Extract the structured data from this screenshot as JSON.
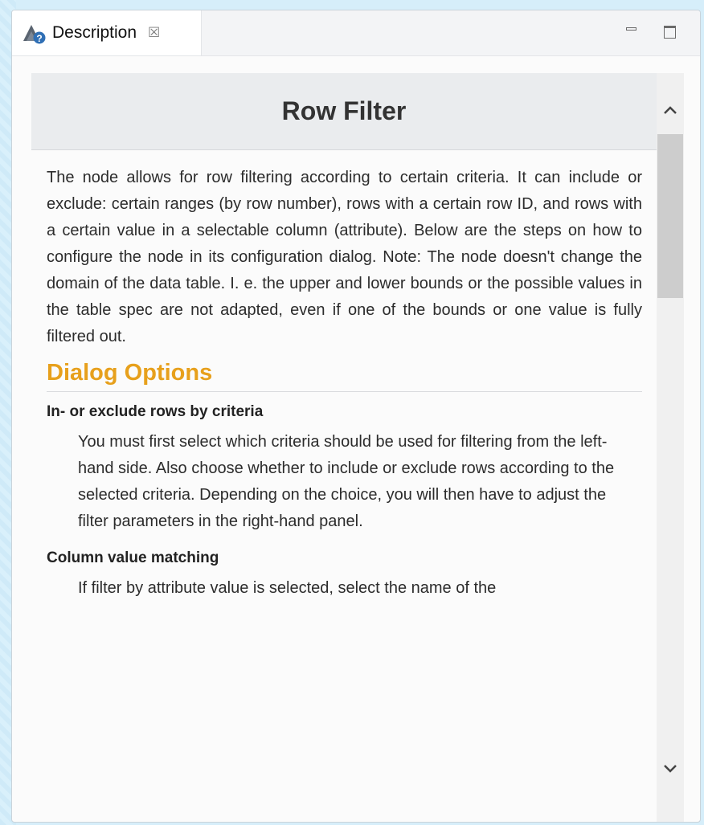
{
  "tab": {
    "label": "Description",
    "icon": "description-help-icon",
    "close_symbol": "☒"
  },
  "window_controls": {
    "minimize": "minimize-icon",
    "maximize": "maximize-icon"
  },
  "node": {
    "title": "Row Filter",
    "description": "The node allows for row filtering according to certain criteria. It can include or exclude: certain ranges (by row number), rows with a certain row ID, and rows with a certain value in a selectable column (attribute). Below are the steps on how to configure the node in its configuration dialog. Note: The node doesn't change the domain of the data table. I. e. the upper and lower bounds or the possible values in the table spec are not adapted, even if one of the bounds or one value is fully filtered out."
  },
  "dialog_options": {
    "heading": "Dialog Options",
    "options": [
      {
        "name": "In- or exclude rows by criteria",
        "description": "You must first select which criteria should be used for filtering from the left-hand side. Also choose whether to include or exclude rows according to the selected criteria. Depending on the choice, you will then have to adjust the filter parameters in the right-hand panel."
      },
      {
        "name": "Column value matching",
        "description": "If filter by attribute value is selected, select the name of the"
      }
    ]
  },
  "colors": {
    "section_heading": "#e7a01c",
    "header_background": "#eaecee"
  }
}
